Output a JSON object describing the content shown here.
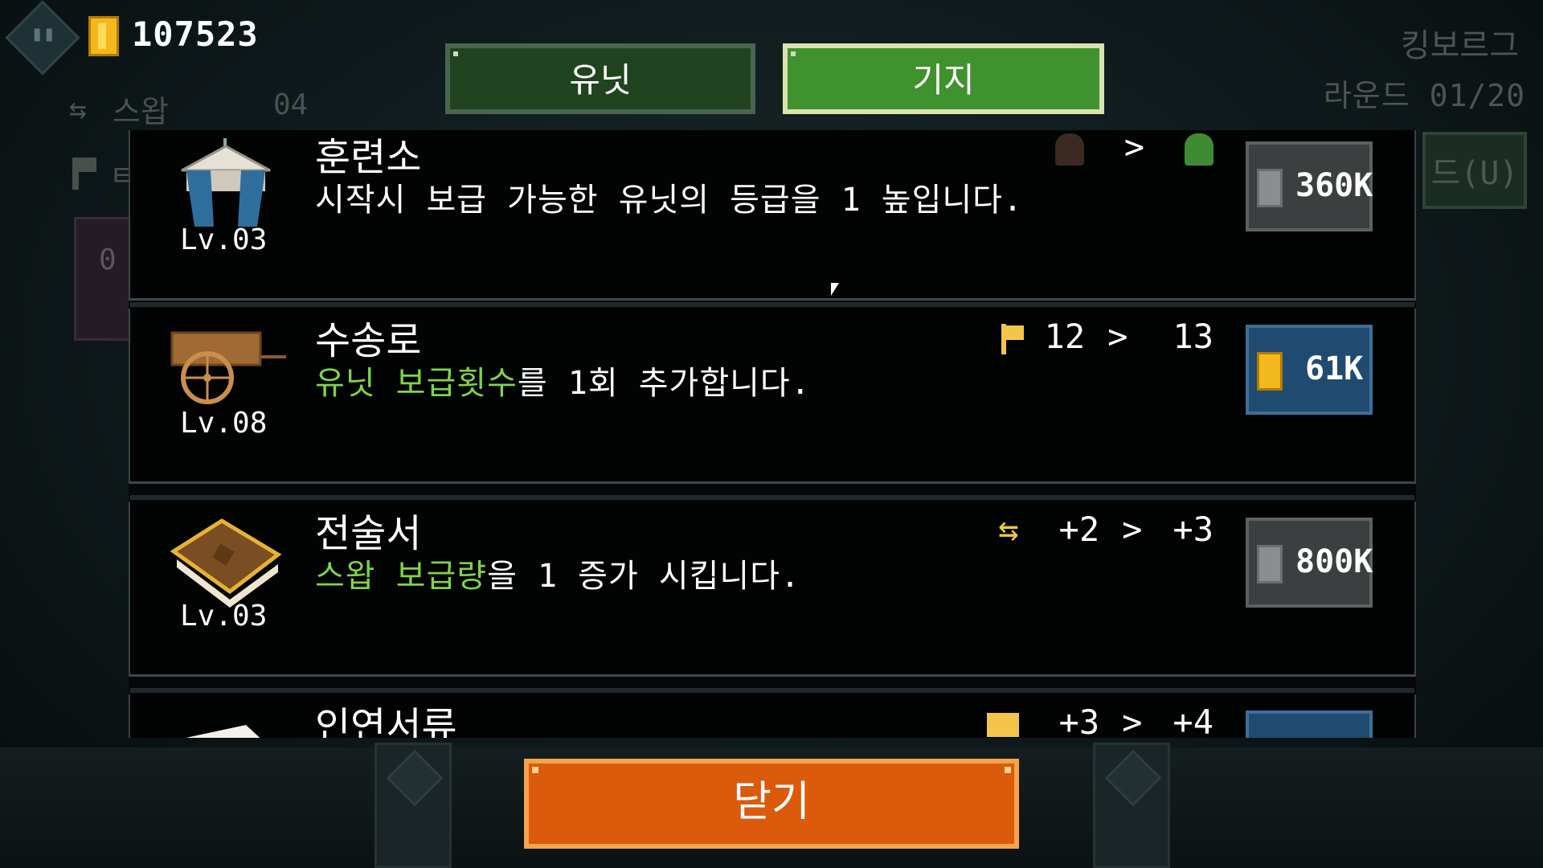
{
  "hud": {
    "gold": "107523",
    "swap_label": "스왑",
    "swap_count": "04",
    "side_letter": "ㅌ",
    "side_count": "0",
    "kingdom": "킹보르그",
    "round": "라운드 01/20",
    "upgrade_button": "드(U)"
  },
  "tabs": {
    "units": "유닛",
    "base": "기지",
    "active": "base"
  },
  "rows": [
    {
      "title": "훈련소",
      "desc_plain": "시작시 보급 가능한 유닛의 등급을 1 높입니다.",
      "level": "Lv.03",
      "effect_from": "",
      "effect_to": "",
      "arrow": ">",
      "price": "360K",
      "price_style": "gray",
      "icon": "tent-icon",
      "effect_icon": "unit-portrait-icon"
    },
    {
      "title": "수송로",
      "desc_hl": "유닛 보급횟수",
      "desc_rest": "를 1회 추가합니다.",
      "level": "Lv.08",
      "effect_from": "12",
      "effect_to": "13",
      "arrow": ">",
      "price": "61K",
      "price_style": "blue",
      "icon": "cart-icon",
      "effect_icon": "flag-icon"
    },
    {
      "title": "전술서",
      "desc_hl": "스왑 보급량",
      "desc_rest": "을 1 증가 시킵니다.",
      "level": "Lv.03",
      "effect_from": "+2",
      "effect_to": "+3",
      "arrow": ">",
      "price": "800K",
      "price_style": "gray",
      "icon": "book-icon",
      "effect_icon": "swap-icon"
    },
    {
      "title": "인연서류",
      "level": "",
      "effect_from": "+3",
      "effect_to": "+4",
      "arrow": ">",
      "price": "",
      "price_style": "blue",
      "icon": "letter-icon",
      "effect_icon": "envelope-icon"
    }
  ],
  "close_button": "닫기",
  "colors": {
    "highlight": "#7fd34a",
    "close": "#dc5a0c",
    "tab_active": "#40922f"
  }
}
